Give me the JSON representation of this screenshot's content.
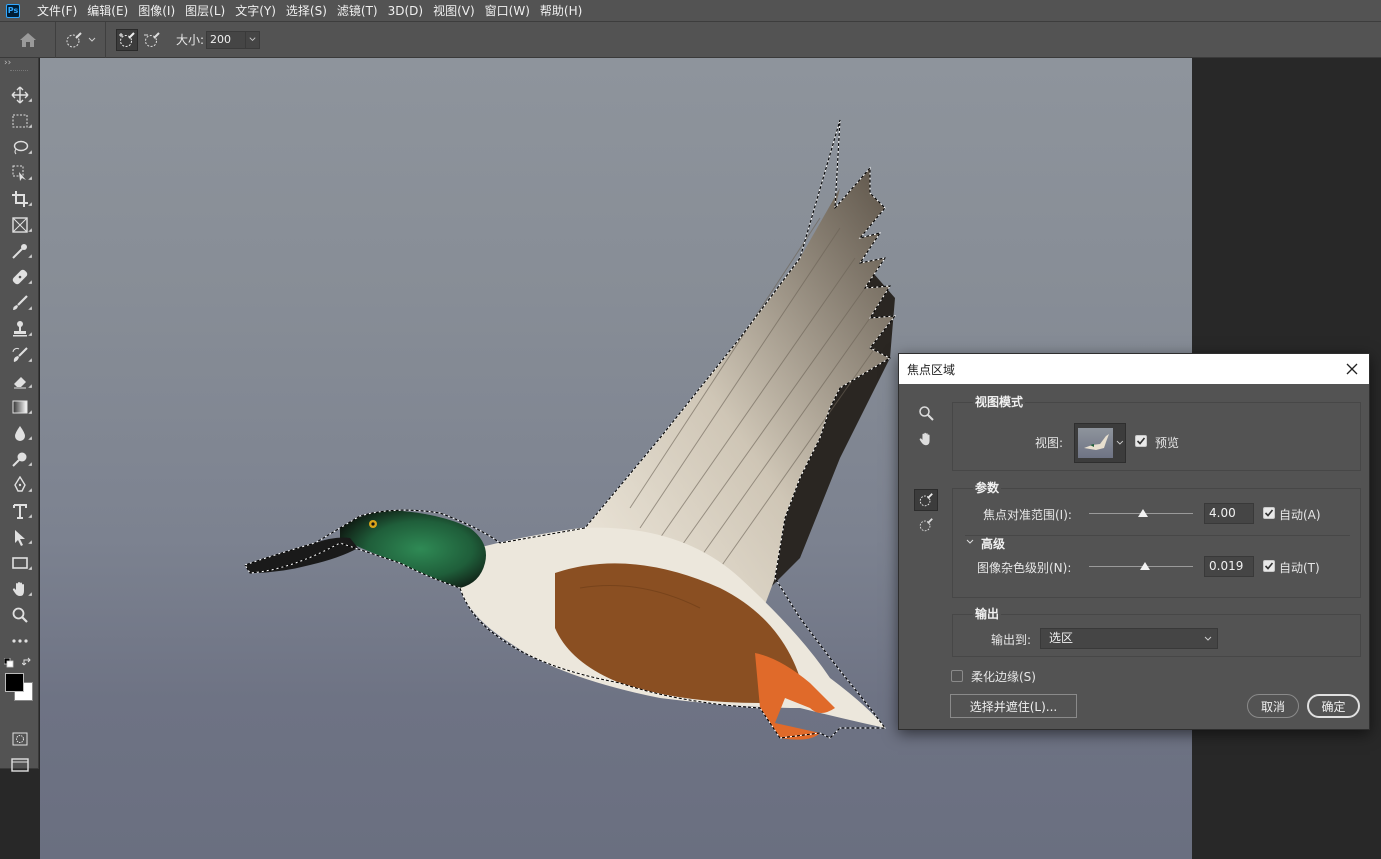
{
  "menubar": {
    "logo": "Ps",
    "items": [
      "文件(F)",
      "编辑(E)",
      "图像(I)",
      "图层(L)",
      "文字(Y)",
      "选择(S)",
      "滤镜(T)",
      "3D(D)",
      "视图(V)",
      "窗口(W)",
      "帮助(H)"
    ]
  },
  "options": {
    "size_label": "大小:",
    "size_value": "200"
  },
  "toolbar": {
    "collapse": "››",
    "tools": [
      "move-tool",
      "marquee-tool",
      "lasso-tool",
      "object-select-tool",
      "crop-tool",
      "frame-tool",
      "eyedropper-tool",
      "healing-brush-tool",
      "brush-tool",
      "clone-stamp-tool",
      "history-brush-tool",
      "eraser-tool",
      "gradient-tool",
      "blur-tool",
      "dodge-tool",
      "pen-tool",
      "type-tool",
      "path-select-tool",
      "rectangle-tool",
      "hand-tool",
      "zoom-tool",
      "more-tools"
    ]
  },
  "dialog": {
    "title": "焦点区域",
    "view_mode": {
      "title": "视图模式",
      "view_label": "视图:",
      "preview_label": "预览",
      "preview_checked": true
    },
    "params": {
      "title": "参数",
      "focus_range_label": "焦点对准范围(I):",
      "focus_range_value": "4.00",
      "focus_range_slider": 0.52,
      "auto_a_label": "自动(A)",
      "advanced_label": "高级",
      "noise_label": "图像杂色级别(N):",
      "noise_value": "0.019",
      "noise_slider": 0.54,
      "auto_t_label": "自动(T)"
    },
    "output": {
      "title": "输出",
      "output_to_label": "输出到:",
      "output_to_value": "选区"
    },
    "soften_label": "柔化边缘(S)",
    "select_mask_button": "选择并遮住(L)...",
    "cancel_button": "取消",
    "ok_button": "确定"
  },
  "colors": {
    "ui_bg": "#535353",
    "canvas_bg": "#282828",
    "duck_head": "#1f5e3a",
    "duck_breast": "#ece7dc",
    "duck_belly": "#8a4f22",
    "duck_feet": "#e06a2a"
  }
}
